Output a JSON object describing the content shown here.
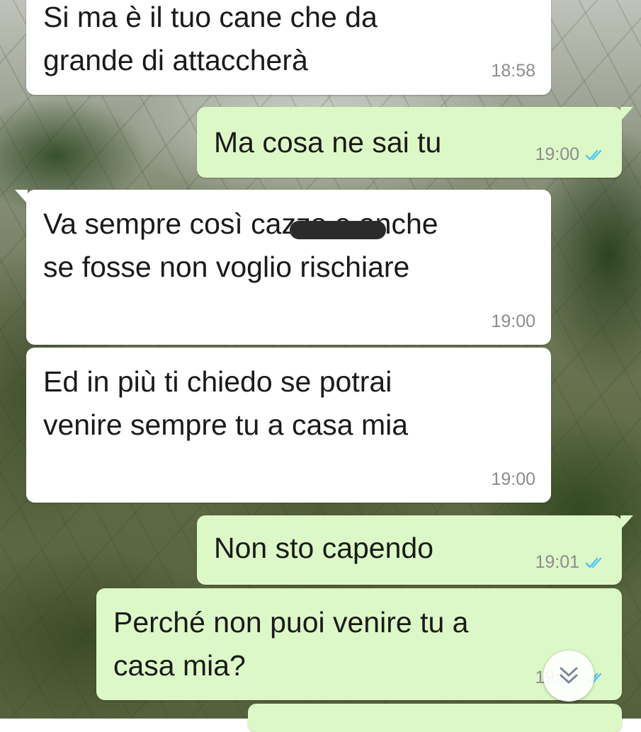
{
  "chat": {
    "messages": [
      {
        "direction": "in",
        "text": "Si ma è il tuo cane che da\ngrande di attaccherà",
        "time": "18:58"
      },
      {
        "direction": "out",
        "text": "Ma cosa ne sai tu",
        "time": "19:00",
        "status": "read"
      },
      {
        "direction": "in",
        "text": "Va sempre così cazzo e anche\nse fosse non voglio rischiare",
        "time": "19:00"
      },
      {
        "direction": "in",
        "text": "Ed in più ti chiedo se potrai\nvenire sempre tu a casa mia",
        "time": "19:00"
      },
      {
        "direction": "out",
        "text": "Non sto capendo",
        "time": "19:01",
        "status": "read"
      },
      {
        "direction": "out",
        "text": "Perché non puoi venire tu a\ncasa mia?",
        "time": "19:01",
        "status": "read"
      }
    ]
  },
  "colors": {
    "incoming_bubble": "#ffffff",
    "outgoing_bubble": "#dcf8c6",
    "read_ticks": "#4fc3f7",
    "timestamp": "#8c8c8c"
  },
  "icons": {
    "read_receipt": "double-check-icon",
    "scroll_down": "chevron-double-down-icon"
  }
}
